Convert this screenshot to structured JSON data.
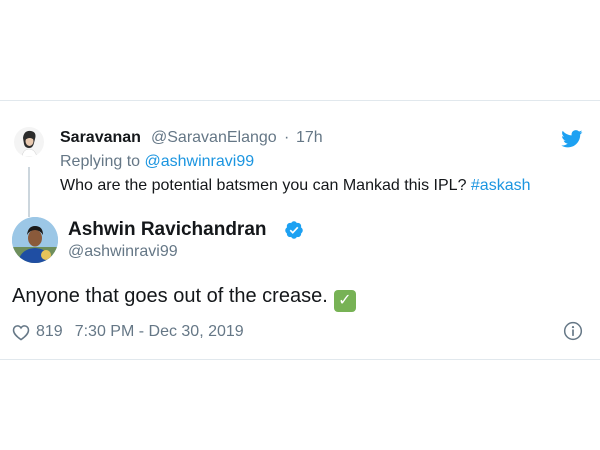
{
  "parent": {
    "name": "Saravanan",
    "handle": "@SaravanElango",
    "separator": "·",
    "time": "17h",
    "replying_prefix": "Replying to",
    "replying_to": "@ashwinravi99",
    "text": "Who are the potential batsmen you can Mankad this IPL? ",
    "hashtag": "#askash",
    "avatar_icon": "avatar-photo"
  },
  "tweet": {
    "name": "Ashwin Ravichandran",
    "handle": "@ashwinravi99",
    "text": "Anyone that goes out of the crease.",
    "emoji": "✓",
    "emoji_icon": "check-mark-emoji",
    "likes": "819",
    "timestamp": "7:30 PM - Dec 30, 2019",
    "verified": true,
    "avatar_icon": "avatar-photo"
  },
  "icons": {
    "brand": "twitter-bird-icon",
    "verified": "verified-badge-icon",
    "like": "heart-icon",
    "info": "info-icon"
  },
  "colors": {
    "link": "#1b95e0",
    "secondary_text": "#657786",
    "primary_text": "#14171a",
    "twitter_blue": "#1da1f2",
    "border": "#e1e8ed",
    "emoji_green": "#77b255"
  }
}
